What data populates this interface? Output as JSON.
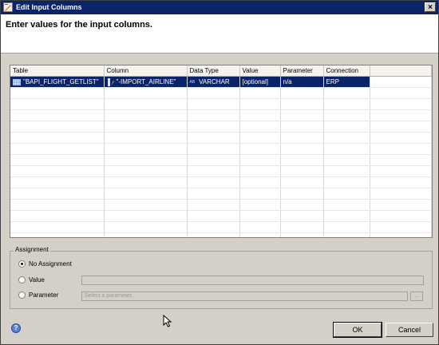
{
  "dialog": {
    "title": "Edit Input Columns",
    "close_glyph": "×",
    "message": "Enter values for the input columns."
  },
  "grid": {
    "columns": [
      "Table",
      "Column",
      "Data Type",
      "Value",
      "Parameter",
      "Connection"
    ],
    "rows": [
      {
        "table": "\"BAPI_FLIGHT_GETLIST\"",
        "column": "\"-IMPORT_AIRLINE\"",
        "type_tag": "AB",
        "data_type": "VARCHAR",
        "value": "[optional]",
        "parameter": "n/a",
        "connection": "ERP",
        "selected": true
      }
    ]
  },
  "assignment": {
    "legend": "Assignment",
    "options": [
      {
        "label": "No Assignment",
        "checked": true
      },
      {
        "label": "Value",
        "checked": false
      },
      {
        "label": "Parameter",
        "checked": false
      }
    ],
    "parameter_placeholder": "Select a parameter...",
    "browse_label": "..."
  },
  "buttons": {
    "ok": "OK",
    "cancel": "Cancel",
    "help_glyph": "?"
  },
  "icons": {
    "app": "edit-dialog-icon",
    "table": "table-grid-icon",
    "column": "column-key-icon",
    "help": "help-icon"
  },
  "colors": {
    "titlebar": "#0a246a",
    "selection": "#0a246a",
    "dialog_bg": "#d4d0c8"
  }
}
